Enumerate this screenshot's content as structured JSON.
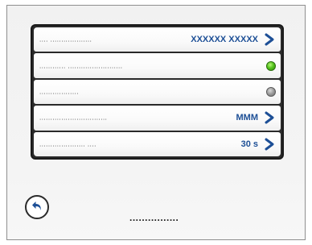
{
  "menu": {
    "rows": [
      {
        "label": ".... ...................",
        "value": "XXXXXX XXXXX",
        "icon": "chevron-right-icon"
      },
      {
        "label": "............ .........................",
        "status": "on",
        "status_color": "#55c51c",
        "icon": "green-led-icon"
      },
      {
        "label": "..................",
        "status": "off",
        "status_color": "#9a9a9a",
        "icon": "gray-led-icon"
      },
      {
        "label": "...............................",
        "value": "MMM",
        "icon": "chevron-right-icon"
      },
      {
        "label": "..................... ....",
        "value": "30 s",
        "icon": "chevron-right-icon"
      }
    ]
  },
  "footer": {
    "back_icon": "back-arrow-icon",
    "text": "................"
  },
  "colors": {
    "accent": "#1d4f96",
    "frame_border": "#8f8f8f",
    "menu_border": "#2a2a2a"
  }
}
